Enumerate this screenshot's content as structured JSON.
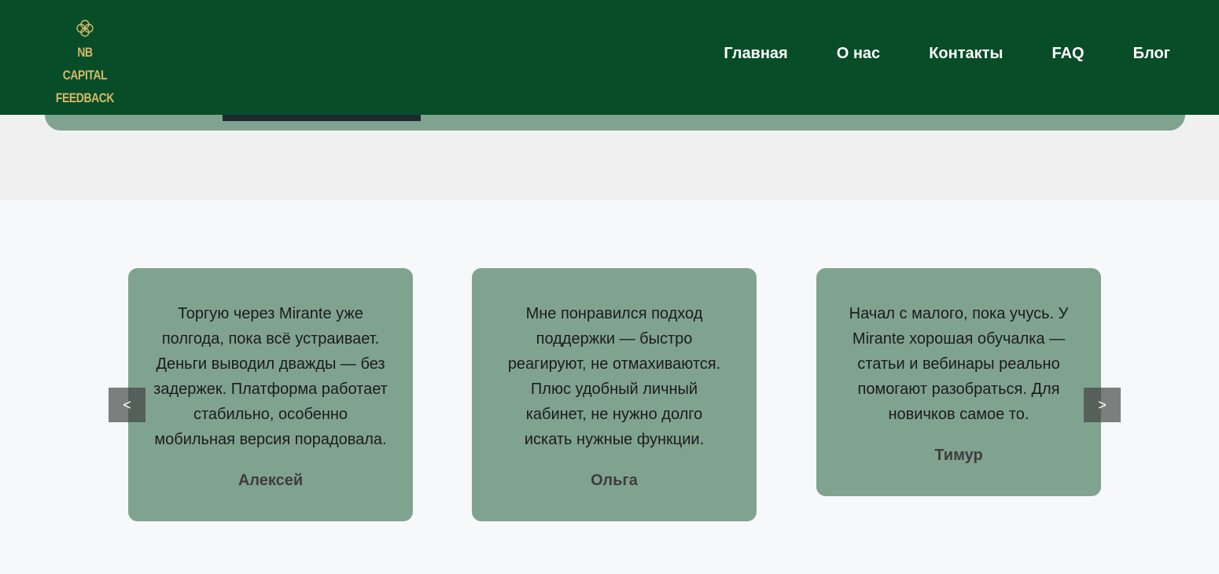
{
  "brand": {
    "line1": "NB CAPITAL",
    "line2": "FEEDBACK",
    "icon": "celtic-knot-icon",
    "color": "#d8b86a"
  },
  "nav": {
    "items": [
      {
        "label": "Главная"
      },
      {
        "label": "О нас"
      },
      {
        "label": "Контакты"
      },
      {
        "label": "FAQ"
      },
      {
        "label": "Блог"
      }
    ]
  },
  "colors": {
    "header_bg": "#074d28",
    "card_bg": "#80a390",
    "page_bg": "#f7f8fa"
  },
  "slider": {
    "prev_label": "<",
    "next_label": ">",
    "testimonials": [
      {
        "text": "Торгую через Mirante уже полгода, пока всё устраивает. Деньги выводил дважды — без задержек. Платформа работает стабильно, особенно мобильная версия порадовала.",
        "author": "Алексей"
      },
      {
        "text": "Мне понравился подход поддержки — быстро реагируют, не отмахиваются. Плюс удобный личный кабинет, не нужно долго искать нужные функции.",
        "author": "Ольга"
      },
      {
        "text": "Начал с малого, пока учусь. У Mirante хорошая обучалка — статьи и вебинары реально помогают разобраться. Для новичков самое то.",
        "author": "Тимур"
      }
    ]
  }
}
